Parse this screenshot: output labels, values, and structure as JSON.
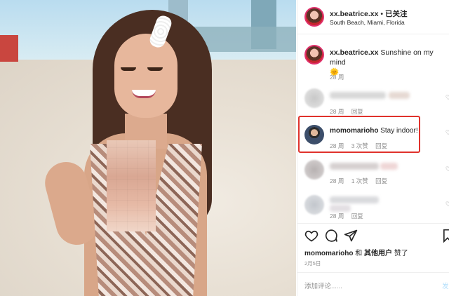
{
  "post_header": {
    "username": "xx.beatrice.xx",
    "separator": "•",
    "follow_label": "已关注",
    "location": "South Beach, Miami, Florida"
  },
  "caption": {
    "username": "xx.beatrice.xx",
    "text": "Sunshine on my mind",
    "emoji": "🌞",
    "time": "28 周"
  },
  "comments": [
    {
      "username_hidden": true,
      "time": "28 周",
      "reply_label": "回复"
    },
    {
      "username": "momomarioho",
      "text": "Stay indoor!",
      "time": "28 周",
      "likes": "3 次赞",
      "reply_label": "回复"
    },
    {
      "username_hidden": true,
      "time": "28 周",
      "likes": "1 次赞",
      "reply_label": "回复"
    },
    {
      "username_hidden": true,
      "time": "28 周",
      "reply_label": "回复"
    }
  ],
  "likes_line": {
    "user": "momomarioho",
    "conjunction": "和",
    "others": "其他用户",
    "suffix": "赞了"
  },
  "post_date": "2月5日",
  "add_comment": {
    "placeholder": "添加评论......",
    "post_label": "发"
  },
  "colors": {
    "highlight_box": "#e0322c",
    "link_blue": "#0095f6",
    "meta_gray": "#8e8e8e"
  }
}
